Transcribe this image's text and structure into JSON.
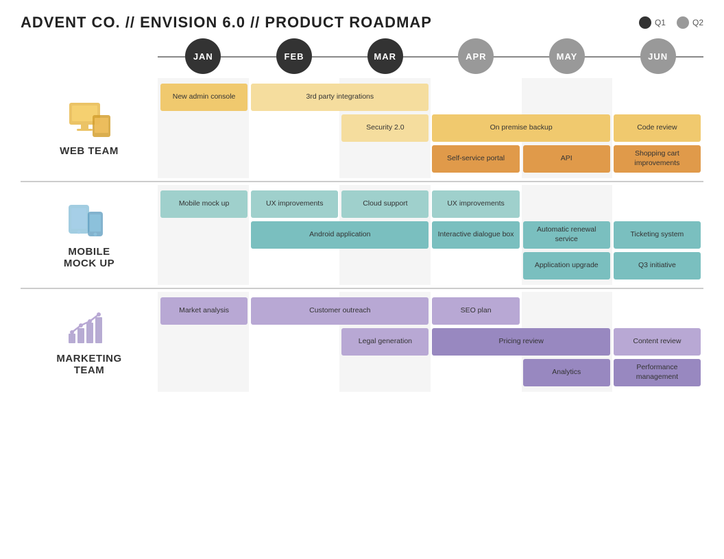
{
  "header": {
    "title": "ADVENT CO.  //  ENVISION 6.0  //  PRODUCT ROADMAP"
  },
  "legend": {
    "q1_label": "Q1",
    "q2_label": "Q2",
    "q1_color": "#333",
    "q2_color": "#999"
  },
  "months": [
    {
      "label": "JAN",
      "quarter": "q1"
    },
    {
      "label": "FEB",
      "quarter": "q1"
    },
    {
      "label": "MAR",
      "quarter": "q1"
    },
    {
      "label": "APR",
      "quarter": "q2"
    },
    {
      "label": "MAY",
      "quarter": "q2"
    },
    {
      "label": "JUN",
      "quarter": "q2"
    }
  ],
  "teams": [
    {
      "id": "web",
      "name": "WEB TEAM",
      "tasks": [
        {
          "text": "New admin console",
          "col_start": 1,
          "col_span": 1,
          "row": 1,
          "color": "yellow"
        },
        {
          "text": "3rd party integrations",
          "col_start": 2,
          "col_span": 2,
          "row": 1,
          "color": "yellow-light"
        },
        {
          "text": "Security 2.0",
          "col_start": 3,
          "col_span": 1,
          "row": 2,
          "color": "yellow-light"
        },
        {
          "text": "On premise backup",
          "col_start": 4,
          "col_span": 2,
          "row": 2,
          "color": "yellow"
        },
        {
          "text": "Code review",
          "col_start": 6,
          "col_span": 1,
          "row": 2,
          "color": "yellow"
        },
        {
          "text": "Self-service portal",
          "col_start": 4,
          "col_span": 1,
          "row": 3,
          "color": "orange"
        },
        {
          "text": "API",
          "col_start": 5,
          "col_span": 1,
          "row": 3,
          "color": "orange"
        },
        {
          "text": "Shopping cart improvements",
          "col_start": 6,
          "col_span": 1,
          "row": 3,
          "color": "orange"
        }
      ]
    },
    {
      "id": "mobile",
      "name": "MOBILE MOCK UP",
      "tasks": [
        {
          "text": "Mobile mock up",
          "col_start": 1,
          "col_span": 1,
          "row": 1,
          "color": "teal-light"
        },
        {
          "text": "UX improvements",
          "col_start": 2,
          "col_span": 1,
          "row": 1,
          "color": "teal-light"
        },
        {
          "text": "Cloud support",
          "col_start": 3,
          "col_span": 1,
          "row": 1,
          "color": "teal-light"
        },
        {
          "text": "UX improvements",
          "col_start": 4,
          "col_span": 1,
          "row": 1,
          "color": "teal-light"
        },
        {
          "text": "Android application",
          "col_start": 2,
          "col_span": 2,
          "row": 2,
          "color": "teal"
        },
        {
          "text": "Interactive dialogue box",
          "col_start": 4,
          "col_span": 1,
          "row": 2,
          "color": "teal"
        },
        {
          "text": "Automatic renewal service",
          "col_start": 5,
          "col_span": 1,
          "row": 2,
          "color": "teal"
        },
        {
          "text": "Ticketing system",
          "col_start": 6,
          "col_span": 1,
          "row": 2,
          "color": "teal"
        },
        {
          "text": "Application upgrade",
          "col_start": 5,
          "col_span": 1,
          "row": 3,
          "color": "teal"
        },
        {
          "text": "Q3 initiative",
          "col_start": 6,
          "col_span": 1,
          "row": 3,
          "color": "teal"
        }
      ]
    },
    {
      "id": "marketing",
      "name": "MARKETING TEAM",
      "tasks": [
        {
          "text": "Market analysis",
          "col_start": 1,
          "col_span": 1,
          "row": 1,
          "color": "purple-light"
        },
        {
          "text": "Customer outreach",
          "col_start": 2,
          "col_span": 2,
          "row": 1,
          "color": "purple-light"
        },
        {
          "text": "SEO plan",
          "col_start": 4,
          "col_span": 1,
          "row": 1,
          "color": "purple-light"
        },
        {
          "text": "Legal generation",
          "col_start": 3,
          "col_span": 1,
          "row": 2,
          "color": "purple-light"
        },
        {
          "text": "Pricing review",
          "col_start": 4,
          "col_span": 2,
          "row": 2,
          "color": "purple-med"
        },
        {
          "text": "Content review",
          "col_start": 6,
          "col_span": 1,
          "row": 2,
          "color": "purple-light"
        },
        {
          "text": "Analytics",
          "col_start": 5,
          "col_span": 1,
          "row": 3,
          "color": "purple-med"
        },
        {
          "text": "Performance management",
          "col_start": 6,
          "col_span": 1,
          "row": 3,
          "color": "purple-med"
        }
      ]
    }
  ]
}
